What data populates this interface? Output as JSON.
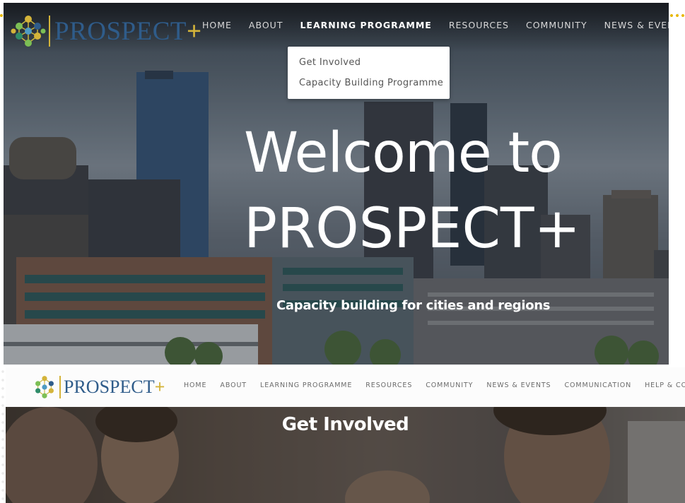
{
  "site": {
    "brand": "PROSPECT",
    "brand_plus": "+"
  },
  "top_view": {
    "nav": [
      "HOME",
      "ABOUT",
      "LEARNING PROGRAMME",
      "RESOURCES",
      "COMMUNITY",
      "NEWS & EVENTS"
    ],
    "active_nav": "LEARNING PROGRAMME",
    "dropdown": [
      "Get Involved",
      "Capacity Building Programme"
    ],
    "hero": {
      "line1": "Welcome to",
      "line2": "PROSPECT+",
      "subtitle": "Capacity building for cities and regions"
    }
  },
  "bottom_view": {
    "nav": [
      "HOME",
      "ABOUT",
      "LEARNING PROGRAMME",
      "RESOURCES",
      "COMMUNITY",
      "NEWS & EVENTS",
      "COMMUNICATION",
      "HELP & CONT"
    ],
    "page_title": "Get Involved"
  },
  "colors": {
    "brand_blue": "#2f5c8a",
    "brand_gold": "#d4b43a",
    "brand_green": "#7cbf55"
  }
}
